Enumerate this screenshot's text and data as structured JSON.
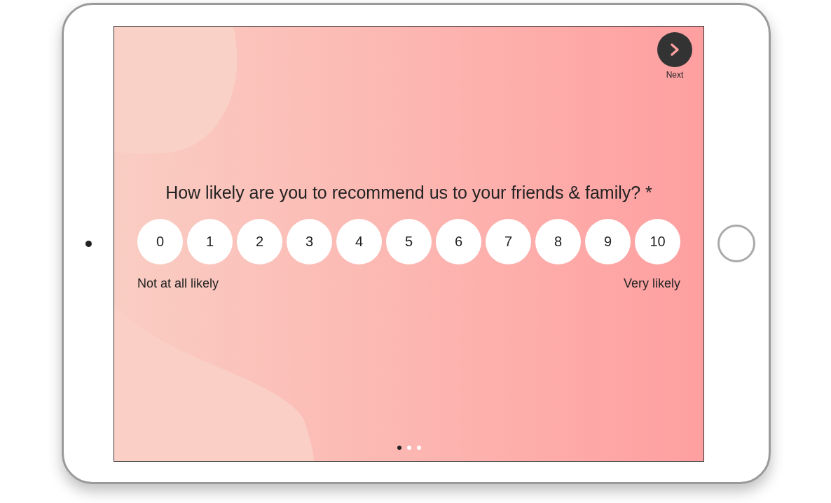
{
  "next_button": {
    "label": "Next"
  },
  "question": {
    "text": "How likely are you to recommend us to your friends & family? *",
    "options": [
      "0",
      "1",
      "2",
      "3",
      "4",
      "5",
      "6",
      "7",
      "8",
      "9",
      "10"
    ],
    "low_label": "Not at all likely",
    "high_label": "Very likely"
  },
  "pagination": [
    {
      "selected": true
    },
    {
      "selected": false
    },
    {
      "selected": false
    }
  ]
}
